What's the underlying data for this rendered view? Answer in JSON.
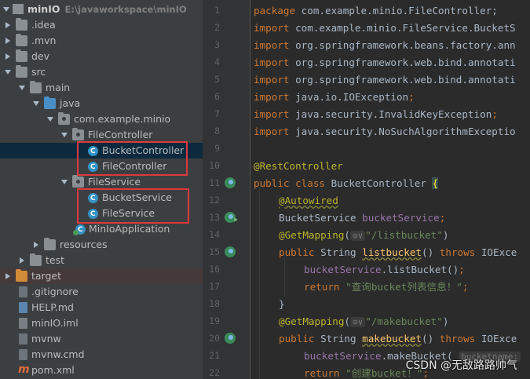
{
  "project": {
    "name": "minIO",
    "path": "E:\\javaworkspace\\minIO",
    "items": [
      {
        "label": "minIO",
        "path": "E:\\javaworkspace\\minIO"
      },
      {
        "label": ".idea"
      },
      {
        "label": ".mvn"
      },
      {
        "label": "dev"
      },
      {
        "label": "src"
      },
      {
        "label": "main"
      },
      {
        "label": "java"
      },
      {
        "label": "com.example.minio"
      },
      {
        "label": "FileController"
      },
      {
        "label": "BucketController"
      },
      {
        "label": "FileController"
      },
      {
        "label": "FileService"
      },
      {
        "label": "BucketService"
      },
      {
        "label": "FileService"
      },
      {
        "label": "MinIoApplication"
      },
      {
        "label": "resources"
      },
      {
        "label": "test"
      },
      {
        "label": "target"
      },
      {
        "label": ".gitignore"
      },
      {
        "label": "HELP.md"
      },
      {
        "label": "minIO.iml"
      },
      {
        "label": "mvnw"
      },
      {
        "label": "mvnw.cmd"
      },
      {
        "label": "pom.xml"
      }
    ]
  },
  "editor": {
    "line_numbers": [
      "1",
      "2",
      "3",
      "4",
      "5",
      "6",
      "7",
      "8",
      "9",
      "10",
      "11",
      "12",
      "13",
      "14",
      "15",
      "16",
      "17",
      "18",
      "19",
      "20",
      "21",
      "22"
    ],
    "lines": {
      "l1a": "package",
      "l1b": " com.example.minio.FileController;",
      "l2a": "import",
      "l2b": " com.example.minio.FileService.BucketS",
      "l3a": "import",
      "l3b": " org.springframework.beans.factory.ann",
      "l4a": "import",
      "l4b": " org.springframework.web.bind.annotati",
      "l5a": "import",
      "l5b": " org.springframework.web.bind.annotati",
      "l6a": "import",
      "l6b": " java.io.IOException",
      "l6c": ";",
      "l7a": "import",
      "l7b": " java.security.InvalidKeyException",
      "l7c": ";",
      "l8a": "import",
      "l8b": " java.security.NoSuchAlgorithmExceptio",
      "l10": "@RestController",
      "l11a": "public class",
      "l11b": " BucketController ",
      "l11c": "{",
      "l12": "@Autowired",
      "l13a": "BucketService ",
      "l13b": "bucketService",
      "l13c": ";",
      "l14a": "@GetMapping",
      "l14b": "(",
      "l14c": "⊙∨",
      "l14d": "\"/listbucket\"",
      "l14e": ")",
      "l15a": "public",
      "l15b": " String ",
      "l15c": "listbucket",
      "l15d": "() ",
      "l15e": "throws",
      "l15f": " IOExce",
      "l16a": "bucketService",
      "l16b": ".listBucket()",
      "l16c": ";",
      "l17a": "return ",
      "l17b": "\"查询bucket列表信息！\"",
      "l17c": ";",
      "l18": "}",
      "l19a": "@GetMapping",
      "l19b": "(",
      "l19c": "⊙∨",
      "l19d": "\"/makebucket\"",
      "l19e": ")",
      "l20a": "public",
      "l20b": " String ",
      "l20c": "makebucket",
      "l20d": "() ",
      "l20e": "throws",
      "l20f": " IOExce",
      "l21a": "bucketService",
      "l21b": ".makeBucket( ",
      "l21c": "bucketname:",
      "l22a": "return ",
      "l22b": "\"创建bucket！\"",
      "l22c": ";"
    }
  },
  "watermark": "CSDN @无敌路路帅气",
  "colors": {
    "keyword": "#cc7832",
    "annotation": "#bbb529",
    "string": "#6a8759",
    "field": "#9876aa",
    "method": "#ffc66d",
    "highlight_box": "#e0383c"
  }
}
